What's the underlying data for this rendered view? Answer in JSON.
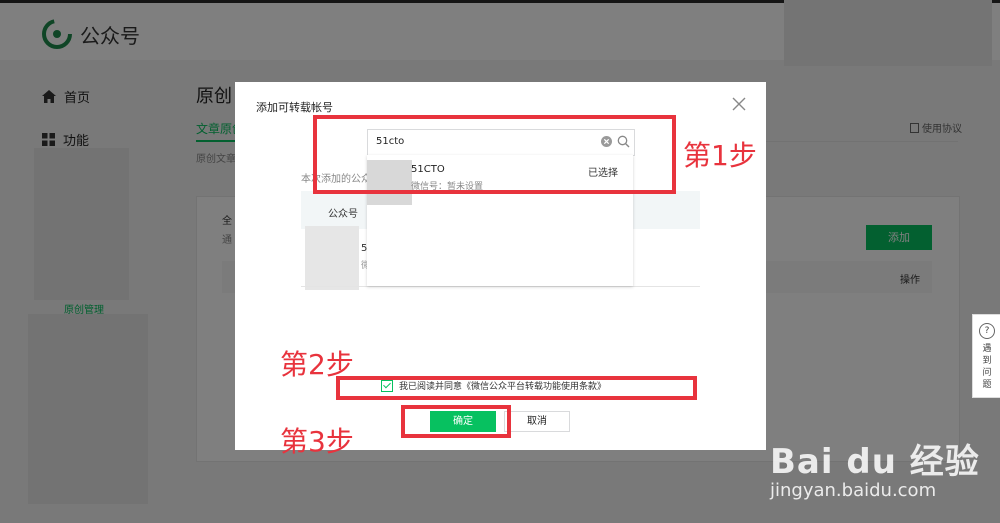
{
  "header": {
    "brand": "公众号"
  },
  "sidebar": {
    "items": [
      {
        "label": "首页",
        "icon": "home-icon"
      },
      {
        "label": "功能",
        "icon": "grid-icon"
      }
    ],
    "active_item": "原创管理"
  },
  "page": {
    "title": "原创",
    "tab_active": "文章原创",
    "tab_desc": "原创文章",
    "protocol_link": "使用协议",
    "all_label": "全",
    "all_sub": "通",
    "add_button": "添加",
    "operation_header": "操作"
  },
  "help_widget": {
    "icon": "?",
    "text": "遇到问题"
  },
  "dialog": {
    "title": "添加可转载帐号",
    "note": "本次添加的公众号",
    "table_header": "公众号",
    "row_name_fragment": "5",
    "row_id_fragment": "微",
    "search": {
      "value": "51cto"
    },
    "dropdown": {
      "name": "51CTO",
      "wechat_id": "微信号：暂未设置",
      "status": "已选择"
    },
    "agree_text": "我已阅读并同意《微信公众平台转载功能使用条款》",
    "confirm_label": "确定",
    "cancel_label": "取消"
  },
  "annotations": {
    "step1": "第1步",
    "step2": "第2步",
    "step3": "第3步",
    "color": "#e8333d"
  },
  "watermark": {
    "main": "Bai du 经验",
    "url": "jingyan.baidu.com"
  },
  "colors": {
    "brand_green": "#07c160",
    "annotation_red": "#e8333d"
  }
}
